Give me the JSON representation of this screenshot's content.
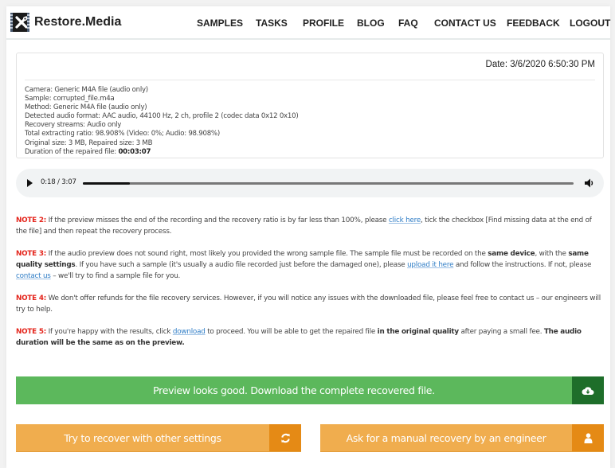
{
  "header": {
    "logo_text": "Restore.Media",
    "nav": [
      "SAMPLES",
      "TASKS",
      "PROFILE",
      "BLOG",
      "FAQ",
      "CONTACT US",
      "FEEDBACK",
      "LOGOUT"
    ]
  },
  "info": {
    "date": "Date: 3/6/2020 6:50:30 PM",
    "lines": [
      "Camera:  Generic M4A file (audio only)",
      "Sample: corrupted_file.m4a",
      "Method:  Generic M4A file (audio only)",
      "Detected audio format: AAC audio, 44100 Hz, 2 ch, profile 2 (codec data 0x12 0x10)",
      "Recovery streams: Audio only",
      "Total extracting ratio: 98.908% (Video: 0%; Audio: 98.908%)",
      "Original size: 3 MB, Repaired size: 3 MB"
    ],
    "duration_label": "Duration of the repaired file: ",
    "duration_value": "00:03:07"
  },
  "audio": {
    "time": "0:18 / 3:07",
    "progress_fraction": 0.096
  },
  "notes": {
    "note2": {
      "label": "NOTE 2:",
      "t1": " If the preview misses the end of the recording and the recovery ratio is by far less than 100%, please ",
      "link": "click here",
      "t2": ", tick the checkbox [Find missing data at the end of the file] and then repeat the recovery process."
    },
    "note3": {
      "label": "NOTE 3:",
      "t1": " If the audio preview does not sound right, most likely you provided the wrong sample file. The sample file must be recorded on the ",
      "b1": "same device",
      "t2": ", with the ",
      "b2": "same quality settings",
      "t3": ". If you have such a sample (it's usually a audio file recorded just before the damaged one), please ",
      "link1": "upload it here",
      "t4": " and follow the instructions. If not, please ",
      "link2": "contact us",
      "t5": " – we'll try to find a sample file for you."
    },
    "note4": {
      "label": "NOTE 4:",
      "t1": " We don't offer refunds for the file recovery services. However, if you will notice any issues with the downloaded file, please feel free to contact us – our engineers will try to help."
    },
    "note5": {
      "label": "NOTE 5:",
      "t1": " If you're happy with the results, click ",
      "link": "download",
      "t2": " to proceed. You will be able to get the repaired file ",
      "b1": "in the original quality",
      "t3": " after paying a small fee. ",
      "b2": "The audio duration will be the same as on the preview."
    }
  },
  "buttons": {
    "download": "Preview looks good. Download the complete recovered file.",
    "retry": "Try to recover with other settings",
    "manual": "Ask for a manual recovery by an engineer"
  },
  "colors": {
    "note_label": "#e4241b",
    "link": "#2f7dc6",
    "green": "#5cb85c",
    "green_dark": "#1e6e2a",
    "orange": "#f0ad4e",
    "orange_dark": "#e58a15"
  }
}
